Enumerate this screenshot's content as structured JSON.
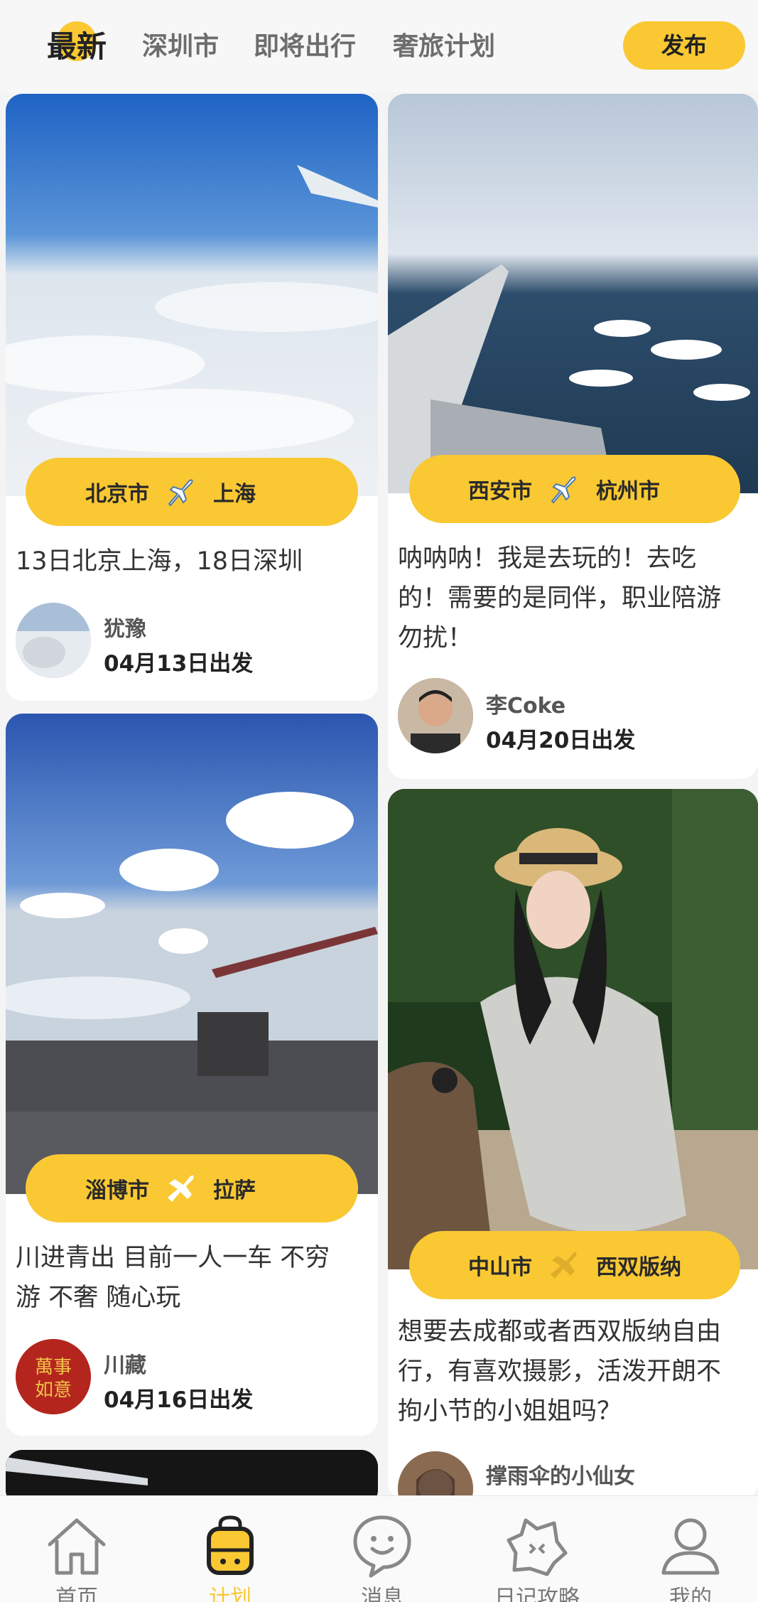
{
  "header": {
    "tabs": [
      {
        "label": "最新",
        "active": true
      },
      {
        "label": "深圳市",
        "active": false
      },
      {
        "label": "即将出行",
        "active": false
      },
      {
        "label": "奢旅计划",
        "active": false
      }
    ],
    "publish_label": "发布"
  },
  "accent_color": "#f9c833",
  "cards": [
    {
      "from": "北京市",
      "to": "上海",
      "plane_icon": "airplane-icon",
      "desc_lines": [
        "13日北京上海，18日深圳"
      ],
      "user": "犹豫",
      "date": "04月13日出发"
    },
    {
      "from": "西安市",
      "to": "杭州市",
      "plane_icon": "airplane-icon",
      "desc_lines": [
        "呐呐呐！我是去玩的！去吃",
        "的！需要的是同伴，职业陪游",
        "勿扰！"
      ],
      "user": "李Coke",
      "date": "04月20日出发"
    },
    {
      "from": "淄博市",
      "to": "拉萨",
      "plane_icon": "airplane-icon",
      "desc_lines": [
        "川进青出  目前一人一车 不穷",
        "游 不奢  随心玩"
      ],
      "user": "川藏",
      "date": "04月16日出发"
    },
    {
      "from": "中山市",
      "to": "西双版纳",
      "plane_icon": "airplane-icon",
      "desc_lines": [
        "想要去成都或者西双版纳自由",
        "行，有喜欢摄影，活泼开朗不",
        "拘小节的小姐姐吗？"
      ],
      "user": "撑雨伞的小仙女",
      "date": ""
    }
  ],
  "nav": [
    {
      "label": "首页",
      "icon": "home-icon",
      "active": false
    },
    {
      "label": "计划",
      "icon": "luggage-icon",
      "active": true
    },
    {
      "label": "消息",
      "icon": "chat-bubble-icon",
      "active": false
    },
    {
      "label": "日记攻略",
      "icon": "diary-icon",
      "active": false
    },
    {
      "label": "我的",
      "icon": "user-icon",
      "active": false
    }
  ]
}
